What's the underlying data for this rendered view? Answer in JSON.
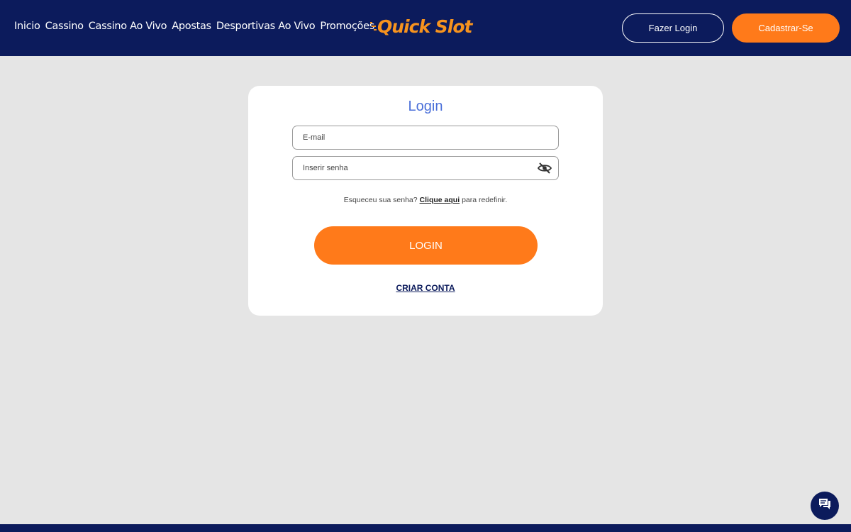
{
  "header": {
    "nav": [
      "Inicio",
      "Cassino",
      "Cassino Ao Vivo",
      "Apostas",
      "Desportivas Ao Vivo",
      "Promoções"
    ],
    "logo_text": "Quick Slot",
    "login_button": "Fazer Login",
    "signup_button": "Cadastrar-Se"
  },
  "login_form": {
    "title": "Login",
    "email_placeholder": "E-mail",
    "password_placeholder": "Inserir senha",
    "forgot_prefix": "Esqueceu sua senha?",
    "forgot_link": "Clique aqui",
    "forgot_suffix": "para redefinir.",
    "submit_label": "LOGIN",
    "create_account_link": "CRIAR CONTA"
  },
  "icons": {
    "password_toggle": "eye-off-icon",
    "chat": "chat-icon"
  },
  "colors": {
    "header_bg": "#0c1b5c",
    "accent": "#ff7a1a",
    "title": "#4a6fd9",
    "page_bg": "#e5e5e5"
  }
}
